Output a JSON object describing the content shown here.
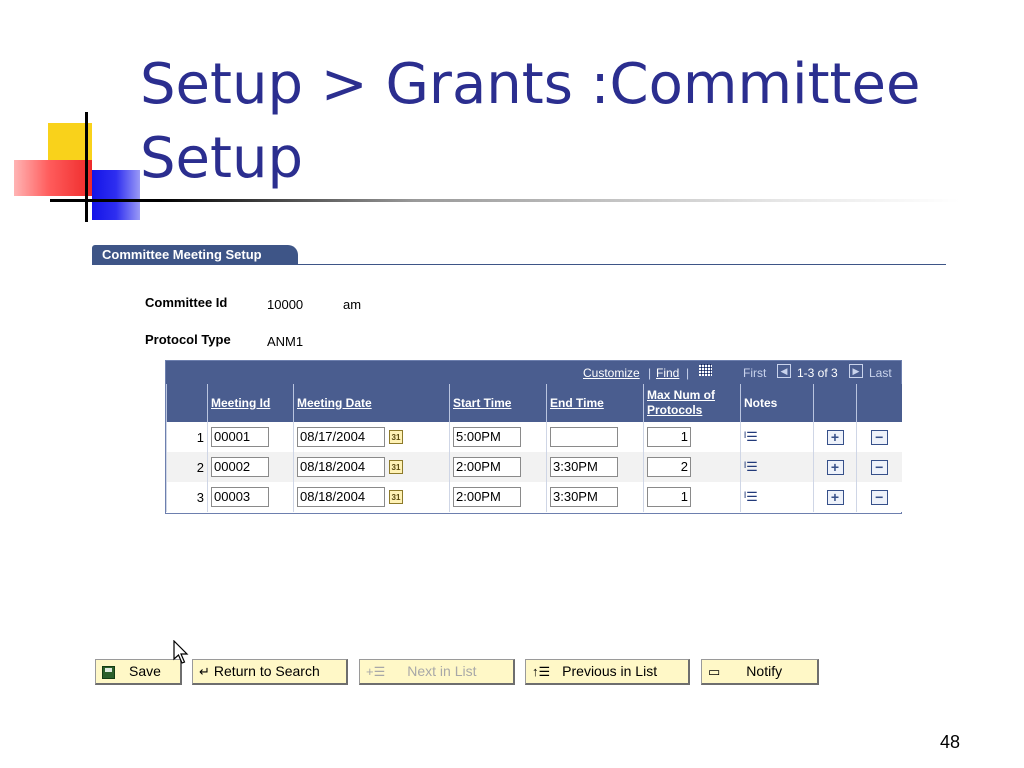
{
  "slide": {
    "title": "Setup > Grants :Committee Setup",
    "page_number": "48"
  },
  "panel": {
    "tab_label": "Committee Meeting Setup",
    "committee_id_label": "Committee Id",
    "committee_id_value": "10000",
    "committee_id_suffix": "am",
    "protocol_type_label": "Protocol Type",
    "protocol_type_value": "ANM1"
  },
  "grid": {
    "customize": "Customize",
    "find": "Find",
    "first": "First",
    "range": "1-3 of 3",
    "last": "Last",
    "columns": [
      "Meeting Id",
      "Meeting Date",
      "Start Time",
      "End Time",
      "Max Num of Protocols",
      "Notes"
    ],
    "rows": [
      {
        "num": "1",
        "meeting_id": "00001",
        "meeting_date": "08/17/2004",
        "start_time": "5:00PM",
        "end_time": "",
        "max_protocols": "1"
      },
      {
        "num": "2",
        "meeting_id": "00002",
        "meeting_date": "08/18/2004",
        "start_time": "2:00PM",
        "end_time": "3:30PM",
        "max_protocols": "2"
      },
      {
        "num": "3",
        "meeting_id": "00003",
        "meeting_date": "08/18/2004",
        "start_time": "2:00PM",
        "end_time": "3:30PM",
        "max_protocols": "1"
      }
    ]
  },
  "toolbar": {
    "save": "Save",
    "return_to_search": "Return to Search",
    "next_in_list": "Next in List",
    "previous_in_list": "Previous in List",
    "notify": "Notify"
  },
  "colors": {
    "title": "#2b2e8f",
    "grid_header": "#4a5d8f",
    "button_face": "#fff8c7"
  }
}
